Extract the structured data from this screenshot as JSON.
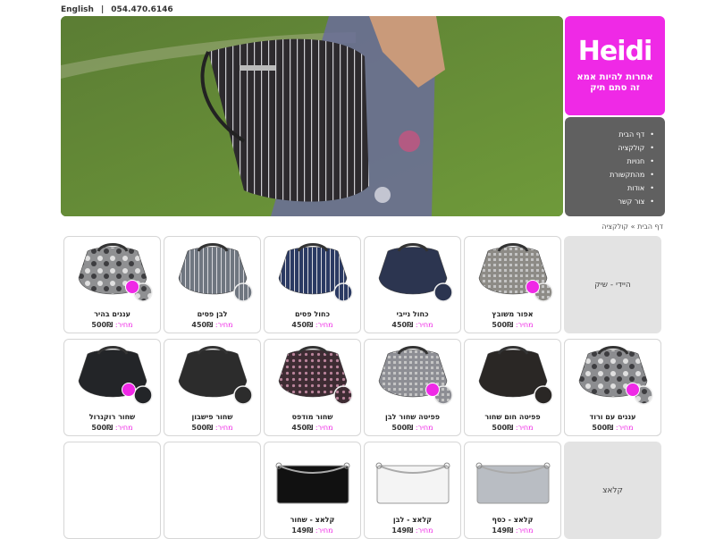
{
  "topbar": {
    "lang": "English",
    "sep": "|",
    "phone": "054.470.6146"
  },
  "logo": {
    "brand": "Heidi",
    "tagline1": "אחרות להיות אמא",
    "tagline2": "זה סתם תיק"
  },
  "nav": [
    "דף הבית",
    "קולקציה",
    "חנויות",
    "מהתקשורת",
    "אודות",
    "צור קשר"
  ],
  "breadcrumb": "דף הבית » קולקציה",
  "price_label": "מחיר:",
  "colors": {
    "accent": "#ef29e6",
    "nav_bg": "#606060",
    "category_bg": "#e3e3e3"
  },
  "rows": [
    {
      "category": "היידי - שיק",
      "items": [
        {
          "name": "אפור משובץ",
          "price": "500₪",
          "color": "#8d8b86",
          "pattern": "check"
        },
        {
          "name": "כחול נייבי",
          "price": "450₪",
          "color": "#2c3550",
          "pattern": "plain"
        },
        {
          "name": "כחול פסים",
          "price": "450₪",
          "color": "#2b3a63",
          "pattern": "stripe"
        },
        {
          "name": "לבן פסים",
          "price": "450₪",
          "color": "#6f7680",
          "pattern": "stripe"
        },
        {
          "name": "עננים בהיר",
          "price": "500₪",
          "color": "#8f9092",
          "pattern": "camo"
        }
      ]
    },
    {
      "category": "",
      "items": [
        {
          "name": "עננים עם ורוד",
          "price": "500₪",
          "color": "#8c8d90",
          "pattern": "camo"
        },
        {
          "name": "פפיטה חום שחור",
          "price": "500₪",
          "color": "#2a2725",
          "pattern": "plain"
        },
        {
          "name": "פפיטה שחור לבן",
          "price": "500₪",
          "color": "#8d8e94",
          "pattern": "check"
        },
        {
          "name": "שחור מודפס",
          "price": "450₪",
          "color": "#3e2c33",
          "pattern": "dots"
        },
        {
          "name": "שחור פישבון",
          "price": "500₪",
          "color": "#2c2c2c",
          "pattern": "plain"
        },
        {
          "name": "שחור רוקנרול",
          "price": "500₪",
          "color": "#232528",
          "pattern": "plain"
        }
      ]
    },
    {
      "category": "קלאצ",
      "items": [
        {
          "name": "קלאצ - כסף",
          "price": "149₪",
          "color": "#b9bdc3",
          "pattern": "clutch"
        },
        {
          "name": "קלאצ - לבן",
          "price": "149₪",
          "color": "#f4f4f4",
          "pattern": "clutch"
        },
        {
          "name": "קלאצ - שחור",
          "price": "149₪",
          "color": "#111111",
          "pattern": "clutch"
        },
        {
          "name": "",
          "price": "",
          "color": "",
          "pattern": "empty"
        },
        {
          "name": "",
          "price": "",
          "color": "",
          "pattern": "empty"
        }
      ]
    }
  ]
}
